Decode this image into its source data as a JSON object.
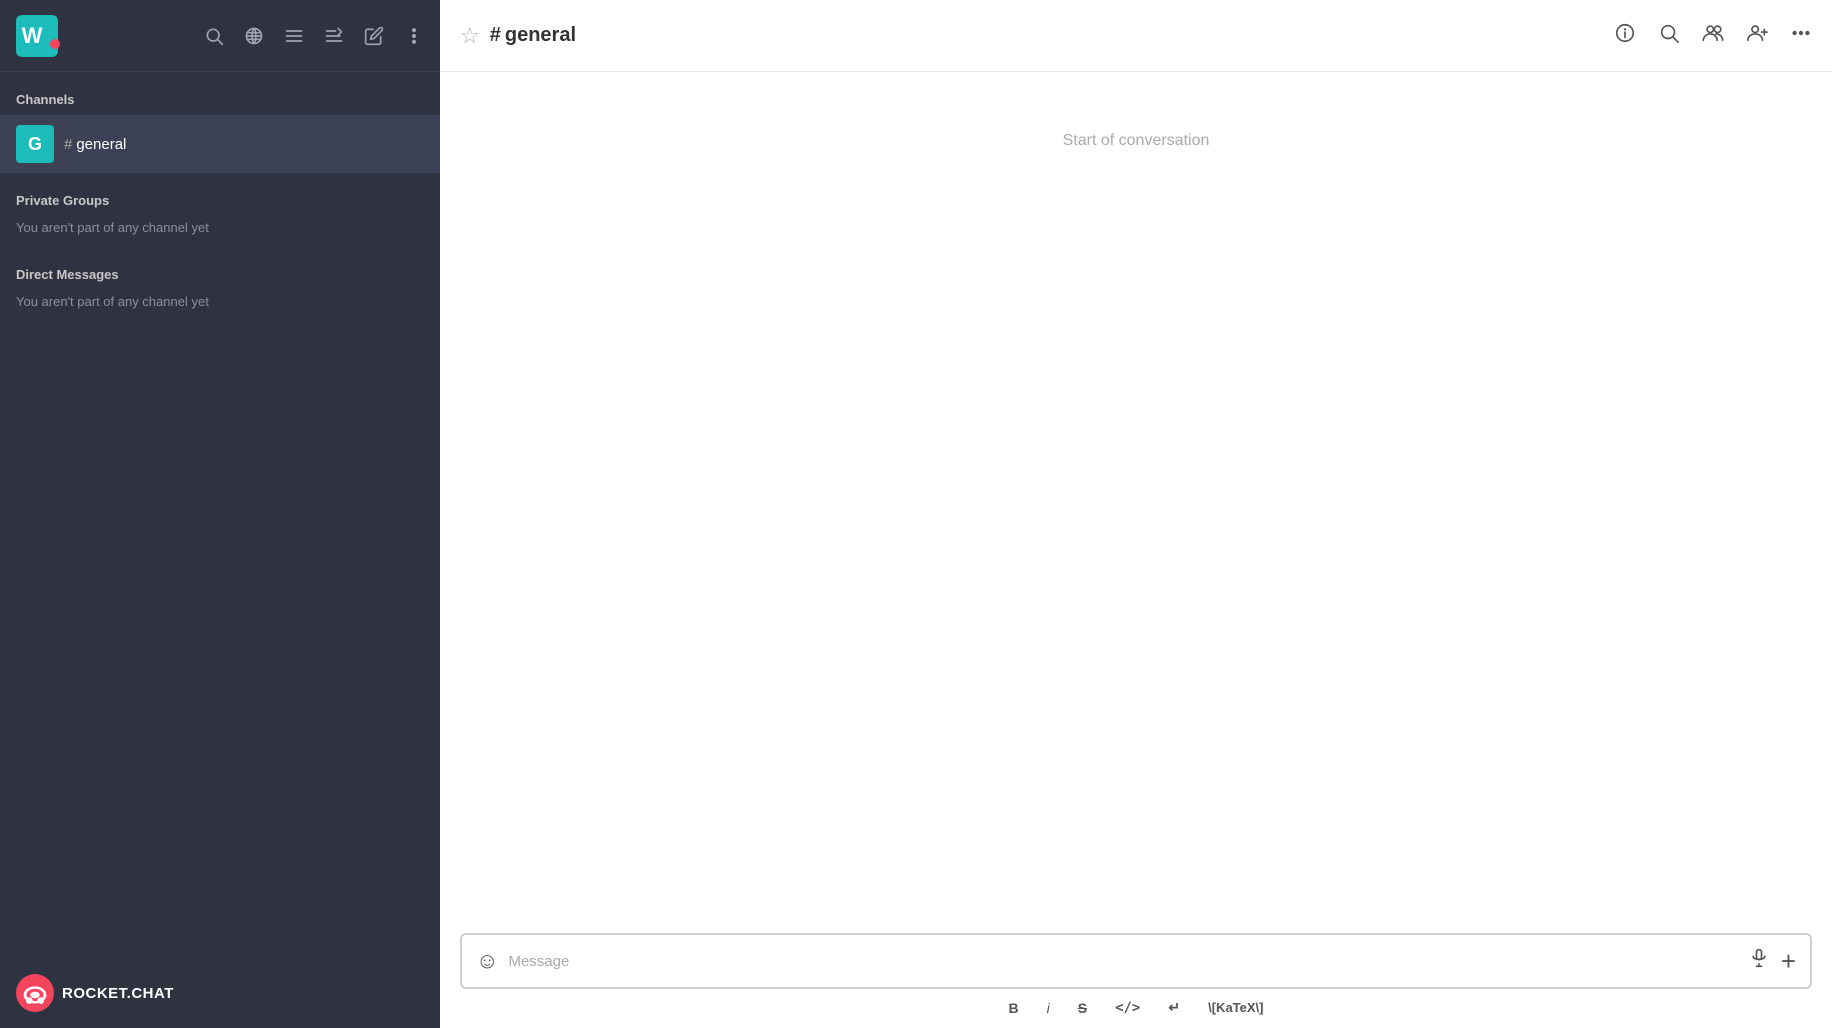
{
  "sidebar": {
    "workspace_initial": "W",
    "workspace_dot_color": "#f5455c",
    "icons": {
      "search": "search-icon",
      "globe": "globe-icon",
      "list": "list-icon",
      "sort": "sort-icon",
      "compose": "compose-icon",
      "more": "more-icon"
    },
    "channels_section": {
      "title": "Channels",
      "items": [
        {
          "avatar_initial": "G",
          "avatar_color": "#1cbcbb",
          "hash": "#",
          "name": "general"
        }
      ]
    },
    "private_groups_section": {
      "title": "Private Groups",
      "empty_text": "You aren't part of any channel yet"
    },
    "direct_messages_section": {
      "title": "Direct Messages",
      "empty_text": "You aren't part of any channel yet"
    },
    "footer": {
      "logo_text": "ROCKET.CHAT"
    }
  },
  "header": {
    "channel_hash": "#",
    "channel_name": "general",
    "star_symbol": "☆",
    "icons": {
      "info": "info-icon",
      "search": "search-icon",
      "members": "members-icon",
      "add_member": "add-member-icon",
      "more": "more-icon"
    }
  },
  "chat": {
    "start_text": "Start of conversation"
  },
  "message_input": {
    "placeholder": "Message",
    "emoji_symbol": "☺",
    "toolbar": {
      "bold": "B",
      "italic": "i",
      "strikethrough": "S",
      "code": "</>",
      "return": "↵",
      "katex": "\\[KaTeX\\]"
    }
  }
}
